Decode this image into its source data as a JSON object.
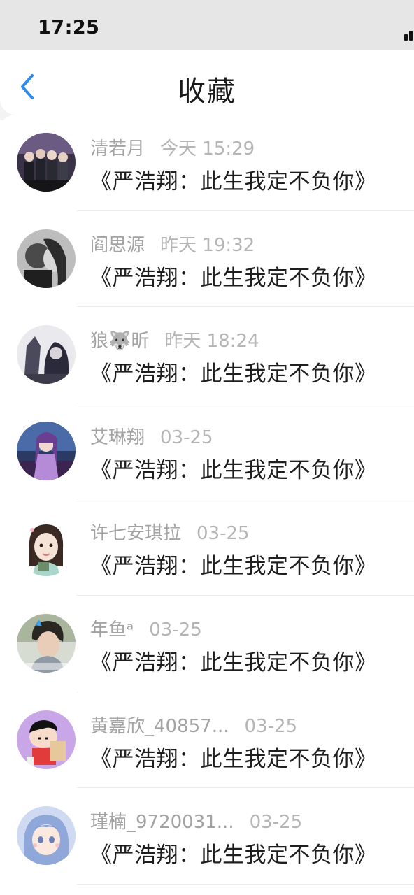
{
  "status_bar": {
    "time": "17:25"
  },
  "header": {
    "title": "收藏",
    "back_icon": "chevron-left-icon",
    "accent_color": "#2f8cf0"
  },
  "favorites": [
    {
      "author": "清若月",
      "time": "今天 15:29",
      "title": "《严浩翔：此生我定不负你》"
    },
    {
      "author": "阎思源",
      "time": "昨天 19:32",
      "title": "《严浩翔：此生我定不负你》"
    },
    {
      "author": "狼🐺昕",
      "time": "昨天 18:24",
      "title": "《严浩翔：此生我定不负你》"
    },
    {
      "author": "艾琳翔",
      "time": "03-25",
      "title": "《严浩翔：此生我定不负你》"
    },
    {
      "author": "许七安琪拉",
      "time": "03-25",
      "title": "《严浩翔：此生我定不负你》"
    },
    {
      "author": "年鱼ᵃ",
      "time": "03-25",
      "title": "《严浩翔：此生我定不负你》"
    },
    {
      "author": "黄嘉欣_40857...",
      "time": "03-25",
      "title": "《严浩翔：此生我定不负你》"
    },
    {
      "author": "瑾楠_9720031...",
      "time": "03-25",
      "title": "《严浩翔：此生我定不负你》"
    }
  ]
}
